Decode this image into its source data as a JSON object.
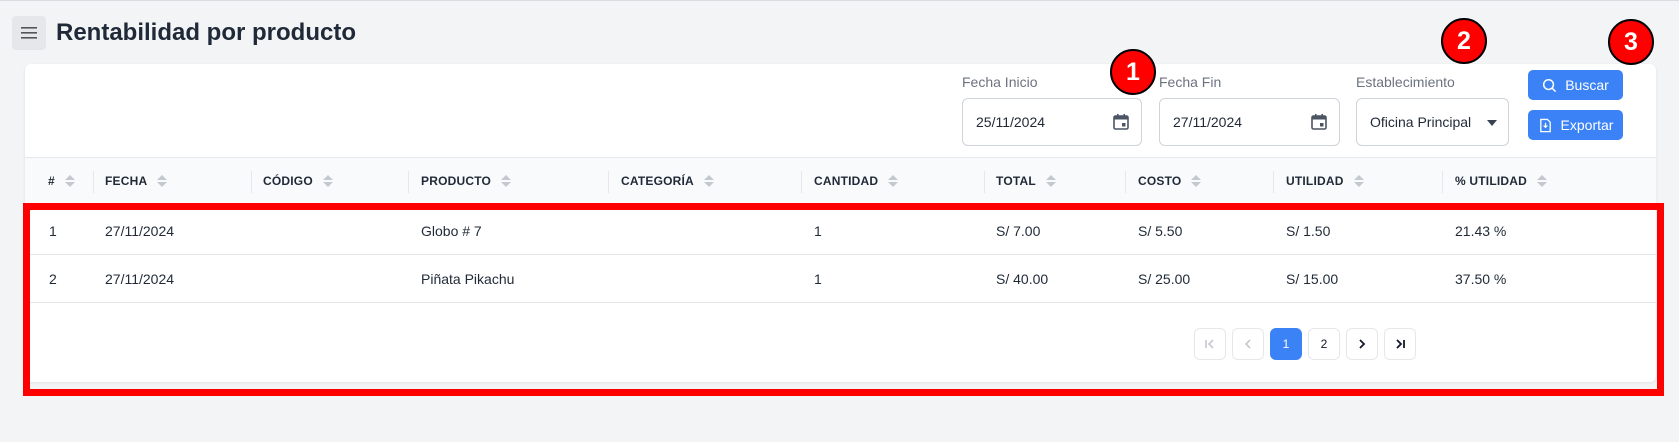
{
  "header": {
    "title": "Rentabilidad por producto",
    "menu_icon": "hamburger-menu-icon"
  },
  "filters": {
    "fecha_inicio": {
      "label": "Fecha Inicio",
      "value": "25/11/2024",
      "icon": "calendar-icon"
    },
    "fecha_fin": {
      "label": "Fecha Fin",
      "value": "27/11/2024",
      "icon": "calendar-icon"
    },
    "establecimiento": {
      "label": "Establecimiento",
      "value": "Oficina Principal",
      "icon": "caret-down-icon"
    }
  },
  "actions": {
    "buscar": {
      "label": "Buscar",
      "icon": "search-icon"
    },
    "exportar": {
      "label": "Exportar",
      "icon": "export-file-icon"
    }
  },
  "table": {
    "columns": [
      "#",
      "FECHA",
      "CÓDIGO",
      "PRODUCTO",
      "CATEGORÍA",
      "CANTIDAD",
      "TOTAL",
      "COSTO",
      "UTILIDAD",
      "% UTILIDAD"
    ],
    "rows": [
      [
        "1",
        "27/11/2024",
        "",
        "Globo # 7",
        "",
        "1",
        "S/ 7.00",
        "S/ 5.50",
        "S/ 1.50",
        "21.43 %"
      ],
      [
        "2",
        "27/11/2024",
        "",
        "Piñata Pikachu",
        "",
        "1",
        "S/ 40.00",
        "S/ 25.00",
        "S/ 15.00",
        "37.50 %"
      ]
    ]
  },
  "pagination": {
    "pages": [
      "1",
      "2"
    ],
    "current": "1"
  },
  "markers": [
    "1",
    "2",
    "3"
  ],
  "colors": {
    "accent": "#3b82f6",
    "highlight": "#ff0000",
    "background": "#f3f4f6"
  }
}
